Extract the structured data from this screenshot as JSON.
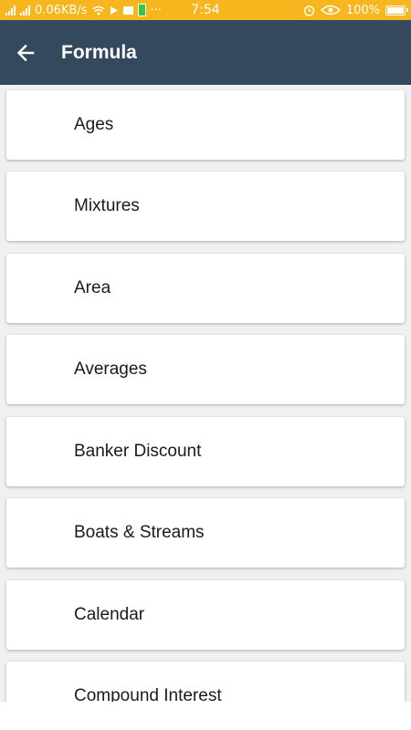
{
  "status_bar": {
    "network_speed": "0.06KB/s",
    "time": "7:54",
    "battery_percent": "100%",
    "icons": [
      "signal-icon",
      "signal-icon",
      "wifi-icon",
      "play-icon",
      "mail-icon",
      "battery-saver-icon",
      "more-icon",
      "alarm-icon",
      "eye-icon",
      "battery-icon"
    ],
    "more_dots": "···"
  },
  "app_bar": {
    "title": "Formula",
    "back_icon": "arrow-left-icon",
    "background_color": "#34495e"
  },
  "formula_list": {
    "items": [
      {
        "label": "Ages"
      },
      {
        "label": "Mixtures"
      },
      {
        "label": "Area"
      },
      {
        "label": "Averages"
      },
      {
        "label": "Banker Discount"
      },
      {
        "label": "Boats & Streams"
      },
      {
        "label": "Calendar"
      },
      {
        "label": "Compound Interest"
      }
    ]
  },
  "colors": {
    "status_bar": "#f7b51e",
    "app_bar": "#34495e",
    "background": "#f0f0f0",
    "card": "#ffffff"
  }
}
